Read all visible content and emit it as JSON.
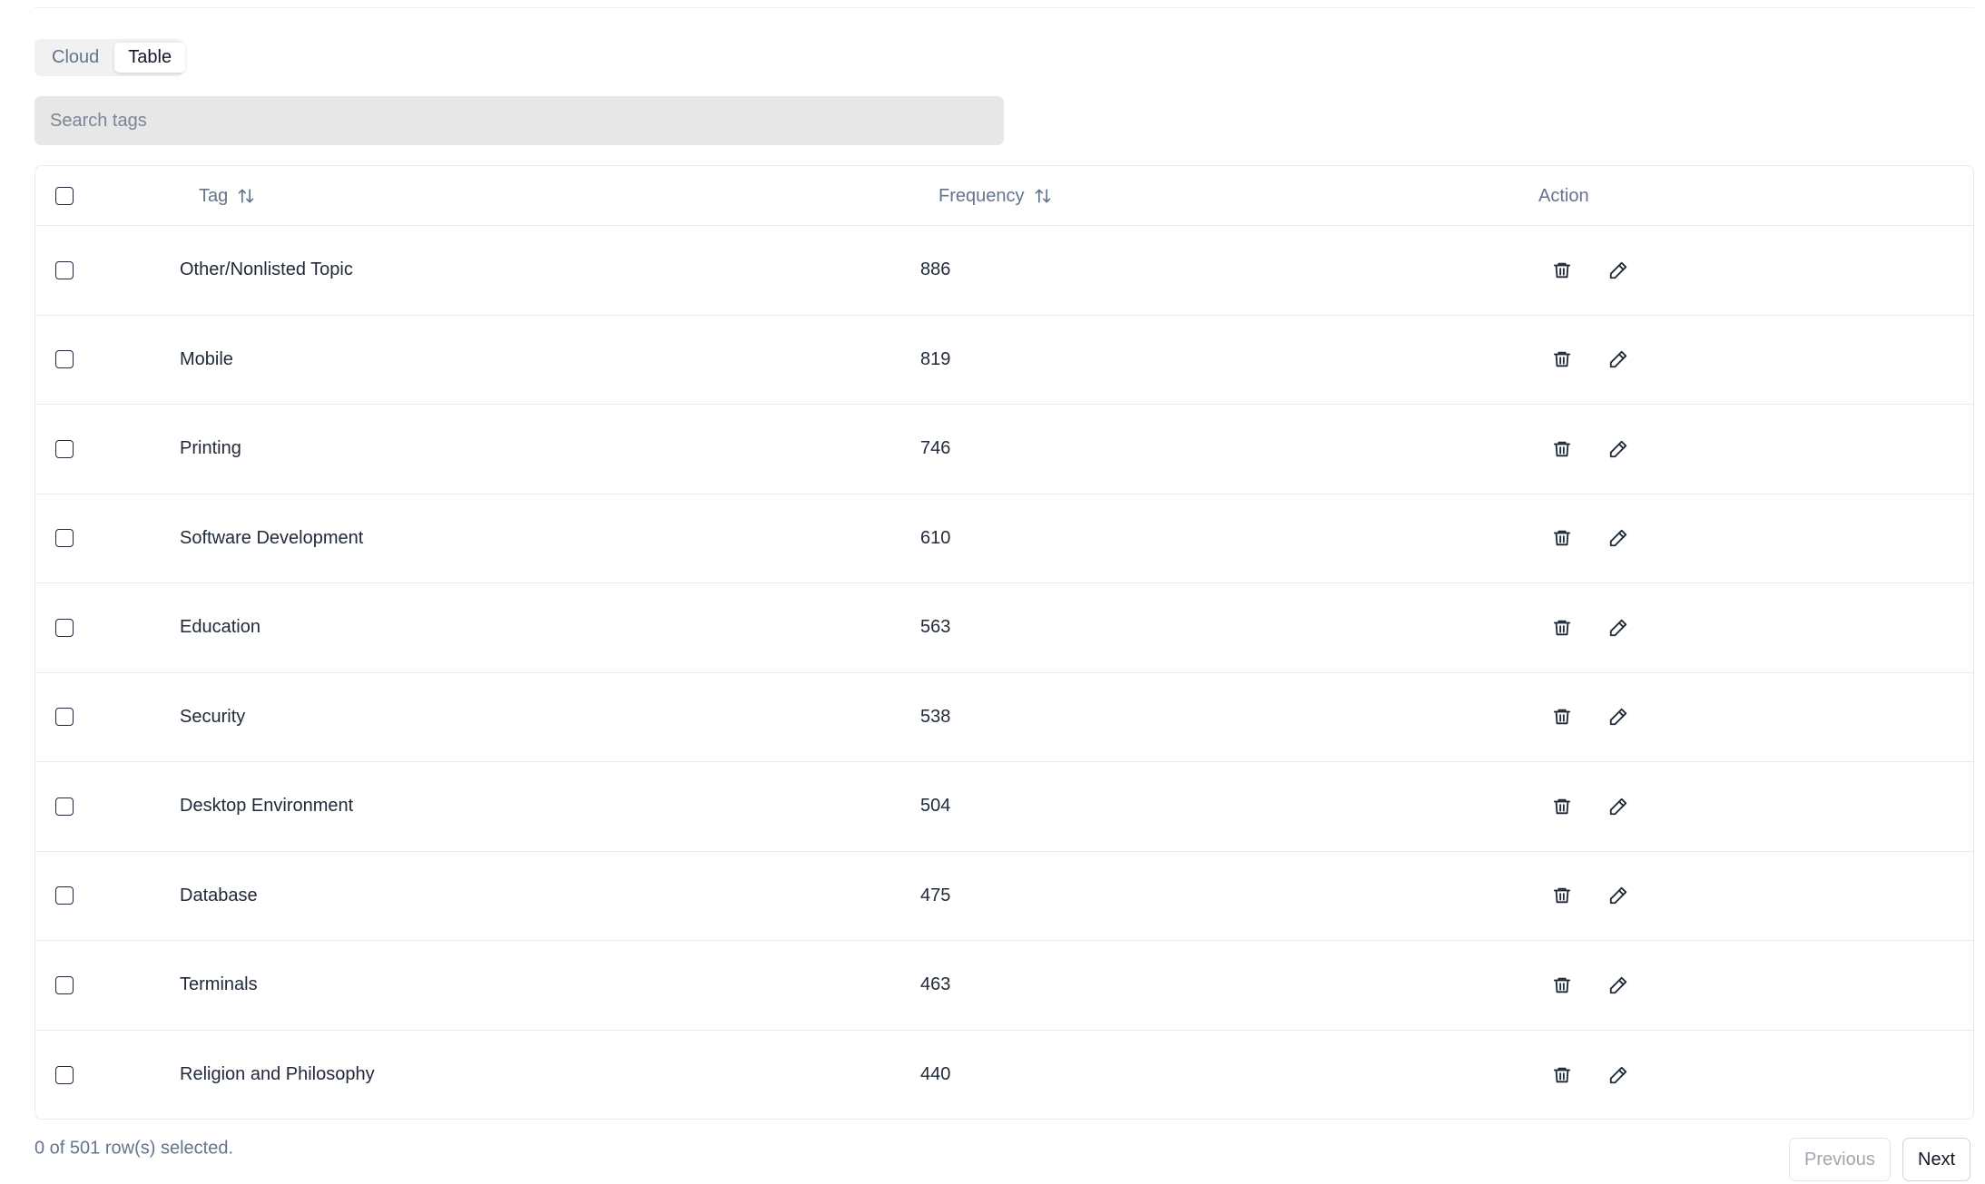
{
  "view_toggle": {
    "options": [
      "Cloud",
      "Table"
    ],
    "selected": "Table"
  },
  "search": {
    "placeholder": "Search tags",
    "value": ""
  },
  "table": {
    "columns": {
      "tag": "Tag",
      "frequency": "Frequency",
      "action": "Action"
    },
    "rows": [
      {
        "tag": "Other/Nonlisted Topic",
        "frequency": "886"
      },
      {
        "tag": "Mobile",
        "frequency": "819"
      },
      {
        "tag": "Printing",
        "frequency": "746"
      },
      {
        "tag": "Software Development",
        "frequency": "610"
      },
      {
        "tag": "Education",
        "frequency": "563"
      },
      {
        "tag": "Security",
        "frequency": "538"
      },
      {
        "tag": "Desktop Environment",
        "frequency": "504"
      },
      {
        "tag": "Database",
        "frequency": "475"
      },
      {
        "tag": "Terminals",
        "frequency": "463"
      },
      {
        "tag": "Religion and Philosophy",
        "frequency": "440"
      }
    ],
    "action_icons": [
      "trash-icon",
      "pencil-icon"
    ]
  },
  "footer": {
    "selection_text": "0 of 501 row(s) selected.",
    "previous_label": "Previous",
    "next_label": "Next",
    "previous_disabled": true
  }
}
